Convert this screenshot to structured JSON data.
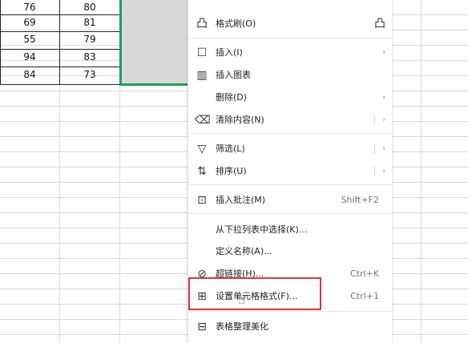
{
  "table": {
    "rows": [
      {
        "a": "76",
        "b": "80"
      },
      {
        "a": "69",
        "b": "81"
      },
      {
        "a": "55",
        "b": "79"
      },
      {
        "a": "94",
        "b": "83"
      },
      {
        "a": "84",
        "b": "73"
      }
    ]
  },
  "menu": {
    "format_painter": {
      "label": "格式刷(O)",
      "icon": "format-painter-icon"
    },
    "insert": {
      "label": "插入(I)",
      "arrow": "›",
      "icon": "insert-icon"
    },
    "insert_chart": {
      "label": "插入图表",
      "icon": "chart-icon"
    },
    "delete": {
      "label": "删除(D)",
      "arrow": "›"
    },
    "clear": {
      "label": "清除内容(N)",
      "arrow": "›",
      "icon": "eraser-icon"
    },
    "filter": {
      "label": "筛选(L)",
      "arrow": "›",
      "icon": "filter-icon"
    },
    "sort": {
      "label": "排序(U)",
      "arrow": "›",
      "icon": "sort-icon"
    },
    "insert_comment": {
      "label": "插入批注(M)",
      "shortcut": "Shift+F2",
      "icon": "comment-icon"
    },
    "pick_from_list": {
      "label": "从下拉列表中选择(K)..."
    },
    "define_name": {
      "label": "定义名称(A)..."
    },
    "hyperlink": {
      "label": "超链接(H)...",
      "shortcut": "Ctrl+K",
      "icon": "link-icon"
    },
    "format_cells": {
      "label": "设置单元格格式(F)...",
      "shortcut": "Ctrl+1",
      "icon": "format-cells-icon"
    },
    "table_beautify": {
      "label": "表格整理美化",
      "icon": "table-beautify-icon"
    }
  },
  "colors": {
    "selection": "#1e9e5c",
    "highlight": "#d83a34"
  }
}
